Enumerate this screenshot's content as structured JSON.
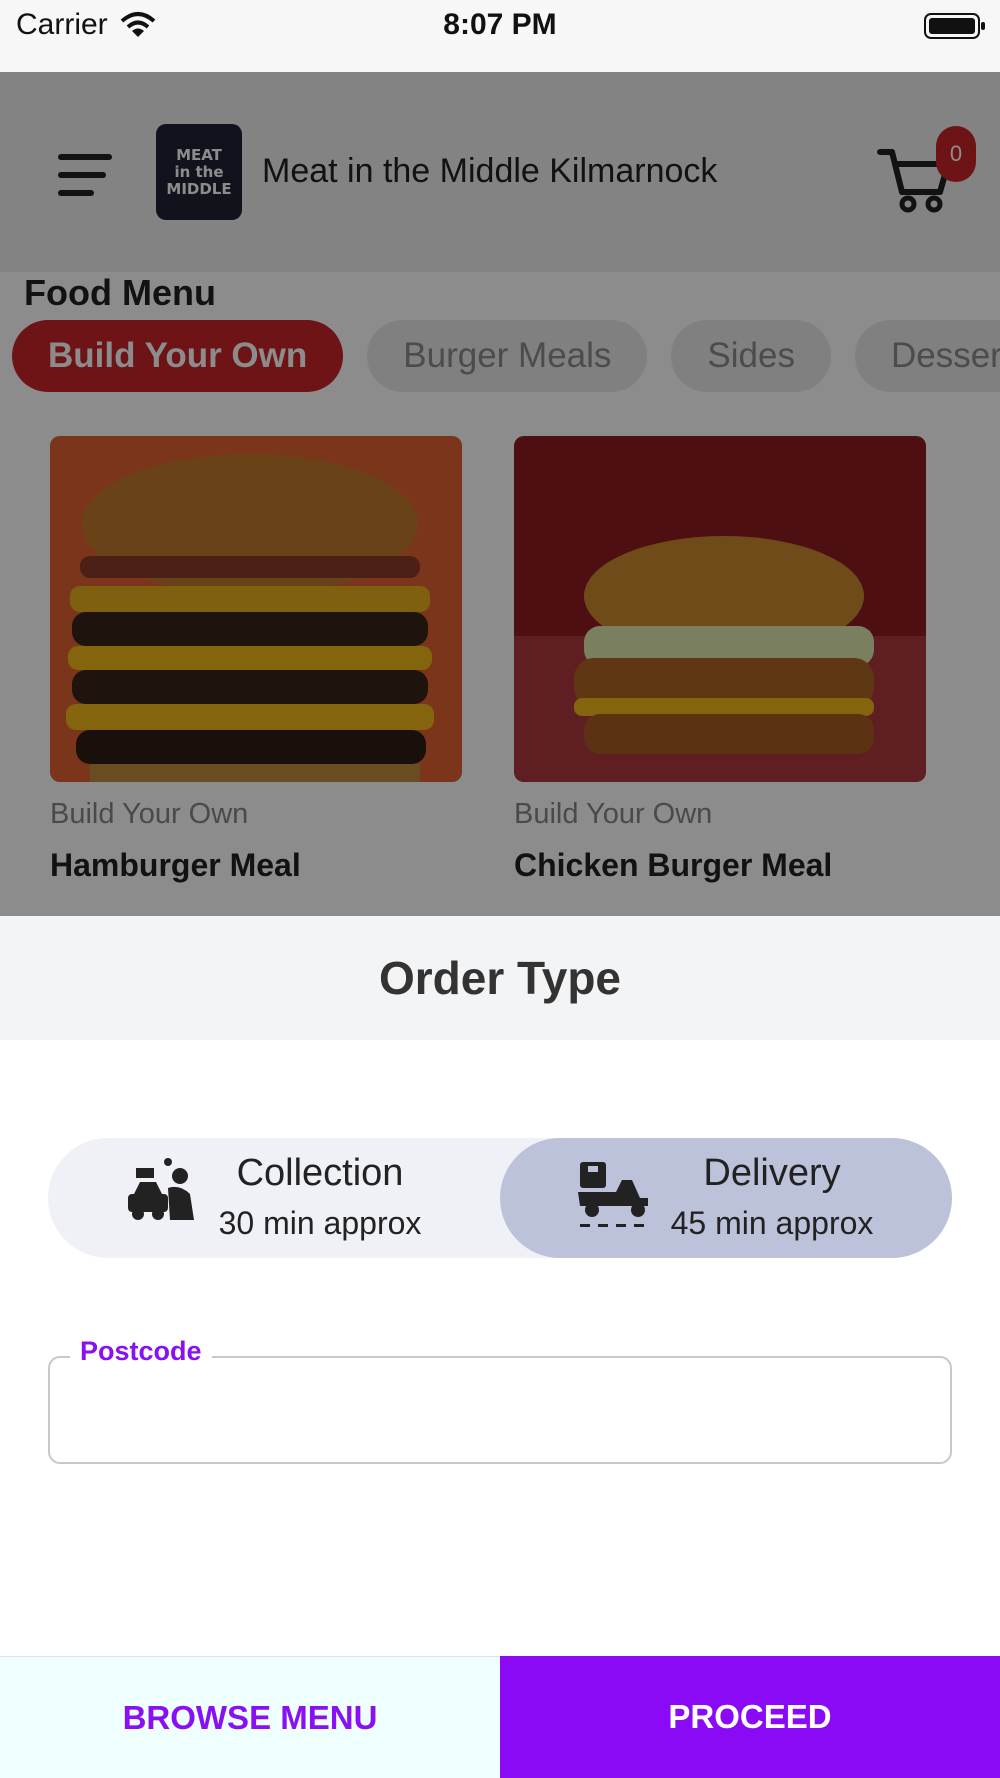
{
  "status_bar": {
    "carrier": "Carrier",
    "time": "8:07 PM"
  },
  "header": {
    "store_name": "Meat in the Middle Kilmarnock",
    "logo_text": "MEAT in the MIDDLE",
    "cart_count": "0"
  },
  "menu": {
    "title": "Food Menu",
    "tabs": [
      {
        "label": "Build Your Own",
        "active": true
      },
      {
        "label": "Burger Meals",
        "active": false
      },
      {
        "label": "Sides",
        "active": false
      },
      {
        "label": "Desserts",
        "active": false
      }
    ],
    "items": [
      {
        "category": "Build Your Own",
        "name": "Hamburger Meal"
      },
      {
        "category": "Build Your Own",
        "name": "Chicken Burger Meal"
      }
    ]
  },
  "order_type": {
    "title": "Order Type",
    "options": [
      {
        "label": "Collection",
        "time": "30 min approx",
        "icon": "collection-car-icon",
        "selected": false
      },
      {
        "label": "Delivery",
        "time": "45 min approx",
        "icon": "delivery-scooter-icon",
        "selected": true
      }
    ],
    "postcode": {
      "label": "Postcode",
      "value": "",
      "placeholder": ""
    }
  },
  "actions": {
    "browse_label": "BROWSE MENU",
    "proceed_label": "PROCEED"
  },
  "colors": {
    "accent": "#8a0af5",
    "brand_red": "#c8262b",
    "selected_segment": "#bcc2da"
  }
}
